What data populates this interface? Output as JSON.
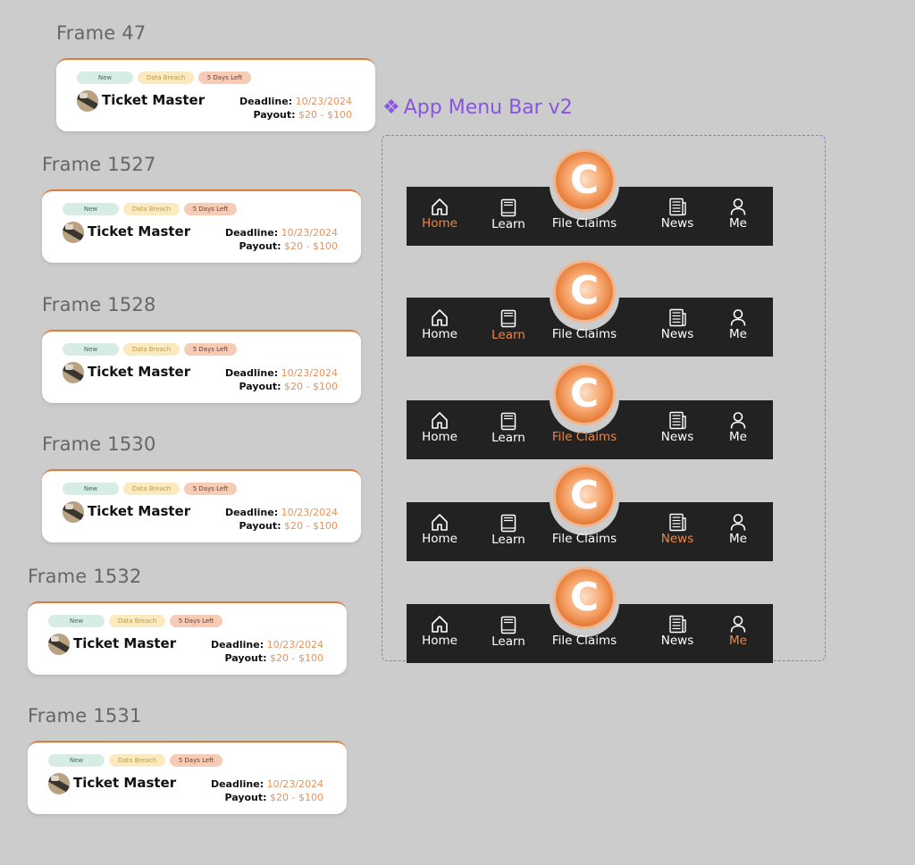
{
  "frames": [
    {
      "label": "Frame 47"
    },
    {
      "label": "Frame 1527"
    },
    {
      "label": "Frame 1528"
    },
    {
      "label": "Frame 1530"
    },
    {
      "label": "Frame 1532"
    },
    {
      "label": "Frame 1531"
    }
  ],
  "card": {
    "tags": {
      "new": "New",
      "breach": "Data Breach",
      "days": "5 Days Left"
    },
    "company": "Ticket Master",
    "deadline_label": "Deadline:",
    "deadline_value": "10/23/2024",
    "payout_label": "Payout:",
    "payout_value": "$20 - $100"
  },
  "component": {
    "title": "App Menu Bar v2",
    "coin_letter": "C",
    "items": {
      "home": "Home",
      "learn": "Learn",
      "claims": "File Claims",
      "news": "News",
      "me": "Me"
    },
    "active_color": "#e8874a",
    "active_per_variant": [
      "home",
      "learn",
      "claims",
      "news",
      "me"
    ]
  },
  "colors": {
    "background": "#cccccc",
    "accent": "#e07a3a",
    "component_outline": "#9b6cf5",
    "menubar": "#222222"
  }
}
